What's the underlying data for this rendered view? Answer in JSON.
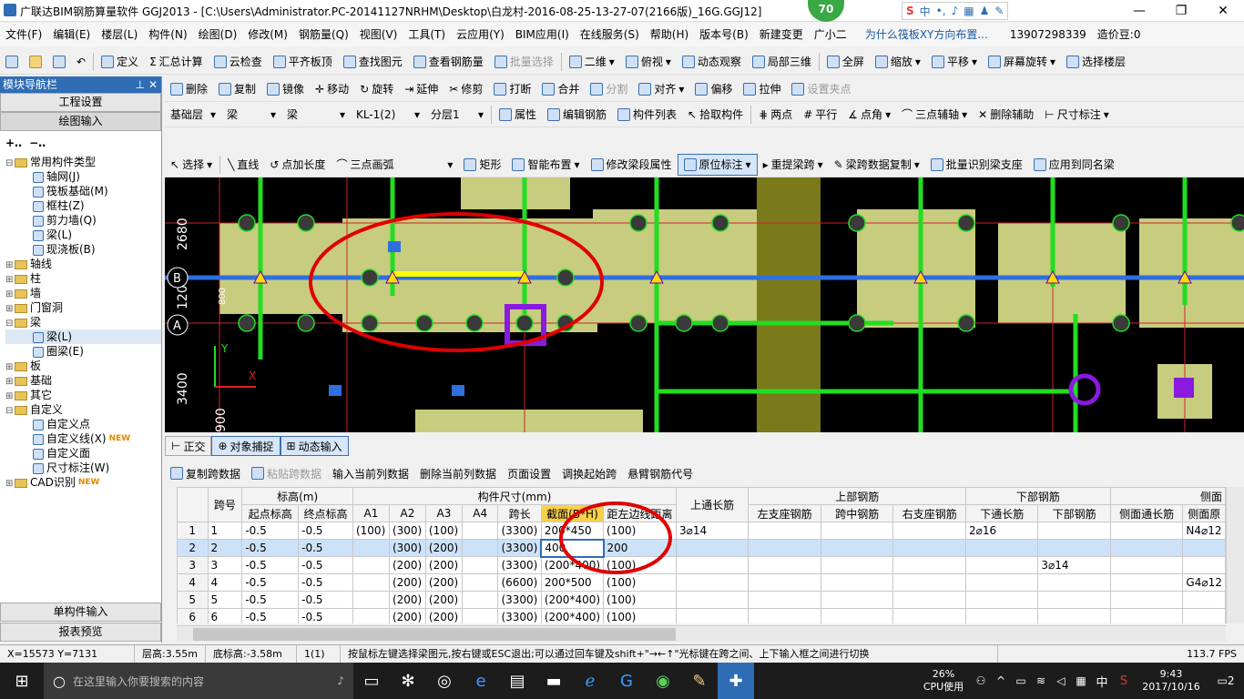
{
  "title": "广联达BIM钢筋算量软件 GGJ2013 - [C:\\Users\\Administrator.PC-20141127NRHM\\Desktop\\白龙村-2016-08-25-13-27-07(2166版)_16G.GGJ12]",
  "badge_count": "70",
  "ime": {
    "label": "中"
  },
  "menu": [
    "文件(F)",
    "编辑(E)",
    "楼层(L)",
    "构件(N)",
    "绘图(D)",
    "修改(M)",
    "钢筋量(Q)",
    "视图(V)",
    "工具(T)",
    "云应用(Y)",
    "BIM应用(I)",
    "在线服务(S)",
    "帮助(H)",
    "版本号(B)",
    "新建变更",
    "广小二",
    "为什么筏板XY方向布置...",
    "13907298339",
    "造价豆:0"
  ],
  "toolbar1": [
    "定义",
    "汇总计算",
    "云检查",
    "平齐板顶",
    "查找图元",
    "查看钢筋量",
    "批量选择",
    "二维",
    "俯视",
    "动态观察",
    "局部三维",
    "全屏",
    "缩放",
    "平移",
    "屏幕旋转",
    "选择楼层"
  ],
  "toolbar2": [
    "删除",
    "复制",
    "镜像",
    "移动",
    "旋转",
    "延伸",
    "修剪",
    "打断",
    "合并",
    "分割",
    "对齐",
    "偏移",
    "拉伸",
    "设置夹点"
  ],
  "toolbar3": {
    "floor": "基础层",
    "type1": "梁",
    "type2": "梁",
    "element": "KL-1(2)",
    "layer": "分层1",
    "buttons": [
      "属性",
      "编辑钢筋",
      "构件列表",
      "拾取构件",
      "两点",
      "平行",
      "点角",
      "三点辅轴",
      "删除辅助",
      "尺寸标注"
    ]
  },
  "toolbar4": [
    "选择",
    "直线",
    "点加长度",
    "三点画弧",
    "矩形",
    "智能布置",
    "修改梁段属性",
    "原位标注",
    "重提梁跨",
    "梁跨数据复制",
    "批量识别梁支座",
    "应用到同名梁"
  ],
  "nav": {
    "header": "模块导航栏",
    "btn_top": "工程设置",
    "btn_draw": "绘图输入",
    "tree": [
      {
        "label": "常用构件类型",
        "indent": 0,
        "exp": "⊟",
        "folder": true
      },
      {
        "label": "轴网(J)",
        "indent": 2
      },
      {
        "label": "筏板基础(M)",
        "indent": 2
      },
      {
        "label": "框柱(Z)",
        "indent": 2
      },
      {
        "label": "剪力墙(Q)",
        "indent": 2
      },
      {
        "label": "梁(L)",
        "indent": 2
      },
      {
        "label": "现浇板(B)",
        "indent": 2
      },
      {
        "label": "轴线",
        "indent": 0,
        "exp": "⊞",
        "folder": true
      },
      {
        "label": "柱",
        "indent": 0,
        "exp": "⊞",
        "folder": true
      },
      {
        "label": "墙",
        "indent": 0,
        "exp": "⊞",
        "folder": true
      },
      {
        "label": "门窗洞",
        "indent": 0,
        "exp": "⊞",
        "folder": true
      },
      {
        "label": "梁",
        "indent": 0,
        "exp": "⊟",
        "folder": true
      },
      {
        "label": "梁(L)",
        "indent": 2,
        "selected": true
      },
      {
        "label": "圈梁(E)",
        "indent": 2
      },
      {
        "label": "板",
        "indent": 0,
        "exp": "⊞",
        "folder": true
      },
      {
        "label": "基础",
        "indent": 0,
        "exp": "⊞",
        "folder": true
      },
      {
        "label": "其它",
        "indent": 0,
        "exp": "⊞",
        "folder": true
      },
      {
        "label": "自定义",
        "indent": 0,
        "exp": "⊟",
        "folder": true
      },
      {
        "label": "自定义点",
        "indent": 2
      },
      {
        "label": "自定义线(X)",
        "indent": 2,
        "new": true
      },
      {
        "label": "自定义面",
        "indent": 2
      },
      {
        "label": "尺寸标注(W)",
        "indent": 2
      },
      {
        "label": "CAD识别",
        "indent": 0,
        "exp": "⊞",
        "folder": true,
        "new": true
      }
    ],
    "btn_single": "单构件输入",
    "btn_report": "报表预览",
    "new_tag": "NEW"
  },
  "canvas": {
    "axis_labels": [
      "2680",
      "1200",
      "3400",
      "900",
      "800"
    ],
    "grid_letters": [
      "B",
      "A"
    ]
  },
  "bottombar": [
    "正交",
    "对象捕捉",
    "动态输入"
  ],
  "gridtoolbar": [
    "复制跨数据",
    "粘贴跨数据",
    "输入当前列数据",
    "删除当前列数据",
    "页面设置",
    "调换起始跨",
    "悬臂钢筋代号"
  ],
  "table": {
    "group_headers": [
      "跨号",
      "标高(m)",
      "构件尺寸(mm)",
      "上通长筋",
      "上部钢筋",
      "下部钢筋",
      "侧面"
    ],
    "sub_headers": [
      "起点标高",
      "终点标高",
      "A1",
      "A2",
      "A3",
      "A4",
      "跨长",
      "截面(B*H)",
      "距左边线距离",
      "左支座钢筋",
      "跨中钢筋",
      "右支座钢筋",
      "下通长筋",
      "下部钢筋",
      "侧面通长筋",
      "侧面原"
    ],
    "rows": [
      {
        "n": "1",
        "c": [
          "1",
          "-0.5",
          "-0.5",
          "(100)",
          "(300)",
          "(100)",
          "",
          "(3300)",
          "200*450",
          "(100)",
          "3⌀14",
          "",
          "",
          "",
          "2⌀16",
          "",
          "",
          "N4⌀12"
        ]
      },
      {
        "n": "2",
        "c": [
          "2",
          "-0.5",
          "-0.5",
          "",
          "(300)",
          "(200)",
          "",
          "(3300)",
          "400",
          "200",
          "",
          "",
          "",
          "",
          "",
          "",
          "",
          ""
        ]
      },
      {
        "n": "3",
        "c": [
          "3",
          "-0.5",
          "-0.5",
          "",
          "(200)",
          "(200)",
          "",
          "(3300)",
          "(200*400)",
          "(100)",
          "",
          "",
          "",
          "",
          "",
          "3⌀14",
          "",
          ""
        ]
      },
      {
        "n": "4",
        "c": [
          "4",
          "-0.5",
          "-0.5",
          "",
          "(200)",
          "(200)",
          "",
          "(6600)",
          "200*500",
          "(100)",
          "",
          "",
          "",
          "",
          "",
          "",
          "",
          "G4⌀12"
        ]
      },
      {
        "n": "5",
        "c": [
          "5",
          "-0.5",
          "-0.5",
          "",
          "(200)",
          "(200)",
          "",
          "(3300)",
          "(200*400)",
          "(100)",
          "",
          "",
          "",
          "",
          "",
          "",
          "",
          ""
        ]
      },
      {
        "n": "6",
        "c": [
          "6",
          "-0.5",
          "-0.5",
          "",
          "(200)",
          "(200)",
          "",
          "(3300)",
          "(200*400)",
          "(100)",
          "",
          "",
          "",
          "",
          "",
          "",
          "",
          ""
        ]
      }
    ]
  },
  "status": [
    "X=15573 Y=7131",
    "层高:3.55m",
    "底标高:-3.58m",
    "1(1)",
    "按鼠标左键选择梁图元,按右键或ESC退出;可以通过回车键及shift+\"→←↑\"光标键在跨之间、上下输入框之间进行切换",
    "113.7 FPS"
  ],
  "taskbar": {
    "search": "在这里输入你要搜索的内容",
    "cpu": "26%",
    "cpu_label": "CPU使用",
    "ime": "中",
    "time": "9:43",
    "date": "2017/10/16",
    "notif": "2"
  }
}
